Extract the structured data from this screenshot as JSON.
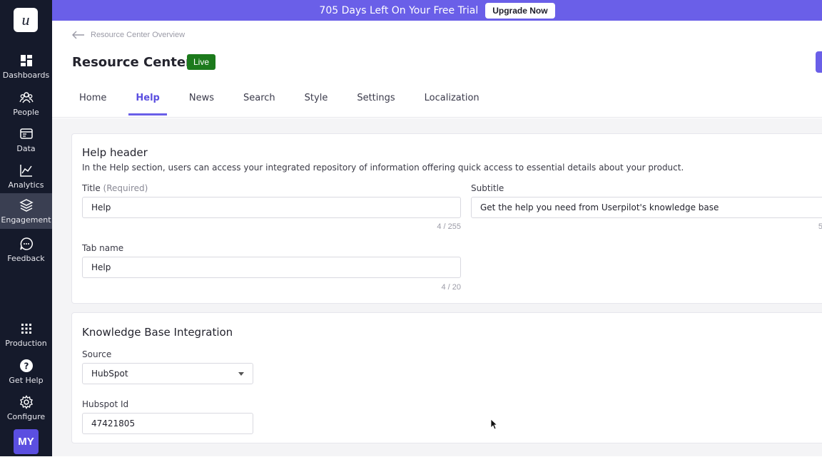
{
  "banner": {
    "text": "705 Days Left On Your Free Trial",
    "upgrade_label": "Upgrade Now"
  },
  "sidebar": {
    "logo": "u",
    "items": [
      {
        "label": "Dashboards",
        "icon": "dashboard-icon"
      },
      {
        "label": "People",
        "icon": "people-icon"
      },
      {
        "label": "Data",
        "icon": "data-icon"
      },
      {
        "label": "Analytics",
        "icon": "analytics-icon"
      },
      {
        "label": "Engagement",
        "icon": "layers-icon",
        "active": true
      },
      {
        "label": "Feedback",
        "icon": "chat-icon"
      },
      {
        "label": "Production",
        "icon": "grid-icon"
      },
      {
        "label": "Get Help",
        "icon": "help-icon"
      },
      {
        "label": "Configure",
        "icon": "gear-icon"
      }
    ],
    "avatar": "MY"
  },
  "header": {
    "breadcrumb": "Resource Center Overview",
    "title": "Resource Center",
    "status": "Live",
    "tabs": [
      "Home",
      "Help",
      "News",
      "Search",
      "Style",
      "Settings",
      "Localization"
    ],
    "active_tab": "Help"
  },
  "help_header": {
    "title": "Help header",
    "description": "In the Help section, users can access your integrated repository of information offering quick access to essential details about your product.",
    "title_label": "Title",
    "title_hint": "(Required)",
    "title_value": "Help",
    "title_counter": "4 / 255",
    "subtitle_label": "Subtitle",
    "subtitle_value": "Get the help you need from Userpilot's knowledge base",
    "subtitle_counter": "5",
    "tab_name_label": "Tab name",
    "tab_name_value": "Help",
    "tab_name_counter": "4 / 20"
  },
  "knowledge_base": {
    "title": "Knowledge Base Integration",
    "source_label": "Source",
    "source_value": "HubSpot",
    "hubspot_id_label": "Hubspot Id",
    "hubspot_id_value": "47421805"
  },
  "colors": {
    "banner": "#6a5fe8",
    "sidebar": "#151a2b",
    "accent": "#5b4fe0",
    "live_badge": "#1c7a1c"
  }
}
